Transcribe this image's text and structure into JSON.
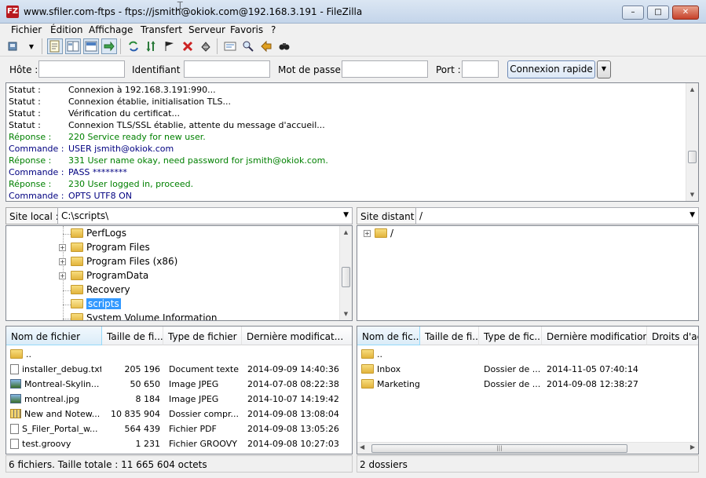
{
  "window": {
    "title": "www.sfiler.com-ftps - ftps://jsmith@okiok.com@192.168.3.191 - FileZilla",
    "app_icon_text": "FZ"
  },
  "window_buttons": {
    "minimize": "–",
    "maximize": "□",
    "close": "✕"
  },
  "menu": [
    "Fichier",
    "Édition",
    "Affichage",
    "Transfert",
    "Serveur",
    "Favoris",
    "?"
  ],
  "quickconnect": {
    "host_label": "Hôte :",
    "user_label": "Identifiant :",
    "password_label": "Mot de passe :",
    "port_label": "Port :",
    "host_value": "",
    "user_value": "",
    "password_value": "",
    "port_value": "",
    "connect_button": "Connexion rapide",
    "dropdown": "▼"
  },
  "log": [
    {
      "type": "Statut :",
      "msg": "Connexion à 192.168.3.191:990...",
      "style": "black"
    },
    {
      "type": "Statut :",
      "msg": "Connexion établie, initialisation TLS...",
      "style": "black"
    },
    {
      "type": "Statut :",
      "msg": "Vérification du certificat...",
      "style": "black"
    },
    {
      "type": "Statut :",
      "msg": "Connexion TLS/SSL établie, attente du message d'accueil...",
      "style": "black"
    },
    {
      "type": "Réponse :",
      "msg": "220 Service ready for new user.",
      "style": "green"
    },
    {
      "type": "Commande :",
      "msg": "USER jsmith@okiok.com",
      "style": "blue"
    },
    {
      "type": "Réponse :",
      "msg": "331 User name okay, need password for jsmith@okiok.com.",
      "style": "green"
    },
    {
      "type": "Commande :",
      "msg": "PASS ********",
      "style": "blue"
    },
    {
      "type": "Réponse :",
      "msg": "230 User logged in, proceed.",
      "style": "green"
    },
    {
      "type": "Commande :",
      "msg": "OPTS UTF8 ON",
      "style": "blue"
    }
  ],
  "local": {
    "site_label": "Site local :",
    "path": "C:\\scripts\\",
    "tree": [
      {
        "label": "PerfLogs",
        "expander": false
      },
      {
        "label": "Program Files",
        "expander": true
      },
      {
        "label": "Program Files (x86)",
        "expander": true
      },
      {
        "label": "ProgramData",
        "expander": true
      },
      {
        "label": "Recovery",
        "expander": false
      },
      {
        "label": "scripts",
        "expander": false,
        "selected": true
      },
      {
        "label": "System Volume Information",
        "expander": false
      }
    ],
    "columns": [
      "Nom de fichier",
      "Taille de fi...",
      "Type de fichier",
      "Dernière modificat..."
    ],
    "files": [
      {
        "name": "..",
        "size": "",
        "type": "",
        "date": "",
        "icon": "folder-icon"
      },
      {
        "name": "installer_debug.txt",
        "size": "205 196",
        "type": "Document texte",
        "date": "2014-09-09 14:40:36",
        "icon": "file-icon"
      },
      {
        "name": "Montreal-Skylin...",
        "size": "50 650",
        "type": "Image JPEG",
        "date": "2014-07-08 08:22:38",
        "icon": "image-icon"
      },
      {
        "name": "montreal.jpg",
        "size": "8 184",
        "type": "Image JPEG",
        "date": "2014-10-07 14:19:42",
        "icon": "image-icon"
      },
      {
        "name": "New and Notew...",
        "size": "10 835 904",
        "type": "Dossier compr...",
        "date": "2014-09-08 13:08:04",
        "icon": "zip-icon"
      },
      {
        "name": "S_Filer_Portal_w...",
        "size": "564 439",
        "type": "Fichier PDF",
        "date": "2014-09-08 13:05:26",
        "icon": "file-icon"
      },
      {
        "name": "test.groovy",
        "size": "1 231",
        "type": "Fichier GROOVY",
        "date": "2014-09-08 10:27:03",
        "icon": "file-icon"
      }
    ],
    "status": "6 fichiers. Taille totale : 11 665 604 octets"
  },
  "remote": {
    "site_label": "Site distant :",
    "path": "/",
    "tree": [
      {
        "label": "/",
        "expander": true
      }
    ],
    "columns": [
      "Nom de fic...",
      "Taille de fi...",
      "Type de fic...",
      "Dernière modification",
      "Droits d'ac..."
    ],
    "files": [
      {
        "name": "..",
        "type": "",
        "date": ""
      },
      {
        "name": "Inbox",
        "type": "Dossier de ...",
        "date": "2014-11-05 07:40:14"
      },
      {
        "name": "Marketing",
        "type": "Dossier de ...",
        "date": "2014-09-08 12:38:27"
      }
    ],
    "status": "2 dossiers"
  },
  "colors": {
    "selection": "#3399ff",
    "response": "#008000",
    "command": "#000080",
    "title_close": "#c7412a"
  }
}
